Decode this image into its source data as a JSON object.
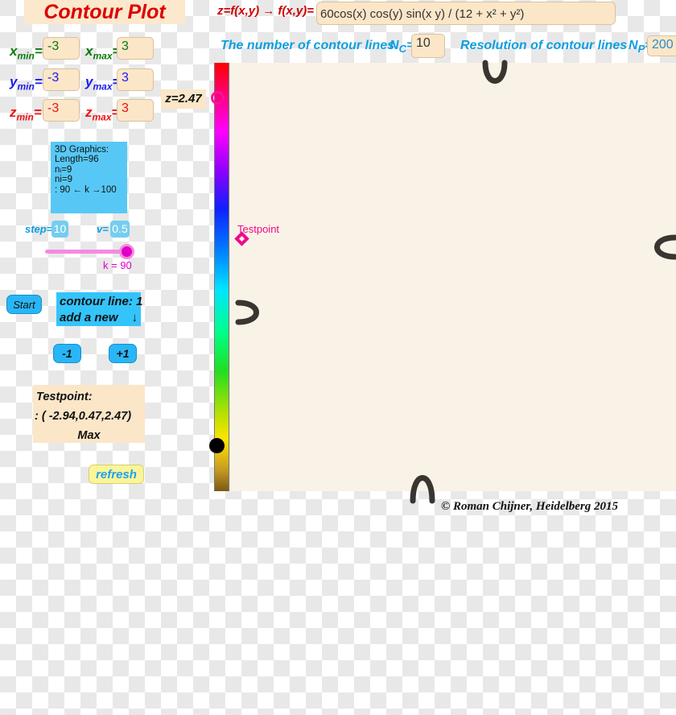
{
  "title": "Contour Plot",
  "ranges": {
    "x": {
      "min_label": "x",
      "min_sub": "min",
      "min_value": "-3",
      "max_label": "x",
      "max_sub": "max",
      "max_value": "3"
    },
    "y": {
      "min_label": "y",
      "min_sub": "min",
      "min_value": "-3",
      "max_label": "y",
      "max_sub": "max",
      "max_value": "3"
    },
    "z": {
      "min_label": "z",
      "min_sub": "min",
      "min_value": "-3",
      "max_label": "z",
      "max_sub": "max",
      "max_value": "3"
    },
    "eq": "="
  },
  "formula": {
    "prefix": "z=f(x,y) →  f(x,y)=",
    "expression": "60cos(x) cos(y) sin(x y) / (12 + x² + y²)"
  },
  "contour_settings": {
    "count_label": "The number of contour lines",
    "count_symbol": "N",
    "count_sub": "C",
    "count_eq": "=",
    "count_value": "10",
    "resolution_label": "Resolution of contour lines",
    "resolution_symbol": "N",
    "resolution_sub": "P",
    "resolution_eq": "=",
    "resolution_value": "200"
  },
  "colorbar": {
    "z_readout": "z=2.47"
  },
  "info3d": {
    "line1": "3D Graphics:",
    "line2": "Length=96",
    "line3": "nᵢ=9",
    "line4": "ni=9",
    "line5": ": 90 ← k →100"
  },
  "controls": {
    "step_label": "step",
    "step_eq": "=",
    "step_value": "10",
    "v_label": "v",
    "v_eq": "=",
    "v_value": "0.5",
    "slider_label": "k = 90",
    "start_label": "Start",
    "contour_line_text": "contour line: 1",
    "add_new_text": "add a new",
    "add_new_arrow": "↓",
    "minus_label": "-1",
    "plus_label": "+1",
    "refresh_label": "refresh"
  },
  "testpoint": {
    "panel_title": "Testpoint:",
    "coords": ": ( -2.94,0.47,2.47)",
    "kind": "Max",
    "plot_label": "Testpoint"
  },
  "copyright": "©  Roman Chijner, Heidelberg 2015",
  "colors": {
    "title_red": "#dd0000",
    "x_green": "#0a7a0a",
    "y_blue": "#1a1aee",
    "z_red": "#ee1111",
    "cyan_label": "#0d9fe0",
    "magenta": "#ee0a8c",
    "panel_cream": "#fbe6c8",
    "panel_blue": "#33c4fa",
    "plot_bg": "#f9f3e7"
  }
}
